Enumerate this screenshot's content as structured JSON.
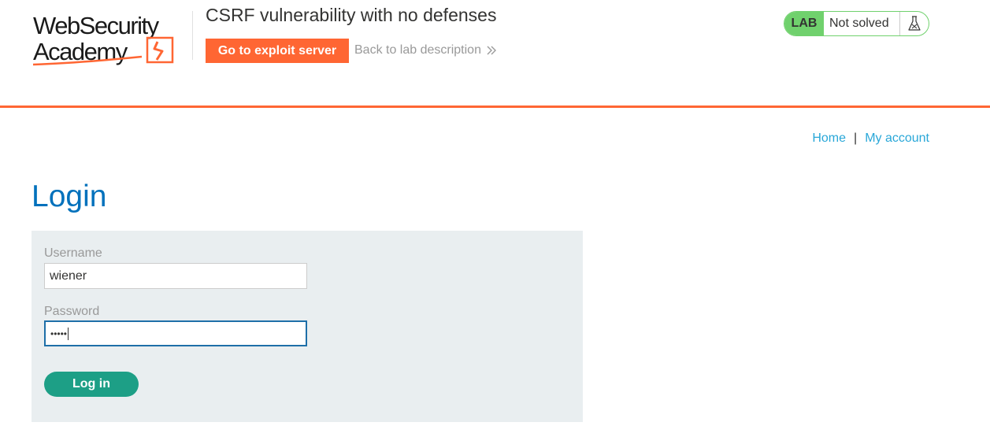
{
  "header": {
    "logo_line1": "WebSecurity",
    "logo_line2": "Academy",
    "lab_title": "CSRF vulnerability with no defenses",
    "exploit_button_label": "Go to exploit server",
    "back_link_label": "Back to lab description",
    "status": {
      "badge": "LAB",
      "text": "Not solved",
      "icon": "flask-icon"
    }
  },
  "nav": {
    "home_label": "Home",
    "separator": "|",
    "account_label": "My account"
  },
  "main": {
    "title": "Login",
    "form": {
      "username_label": "Username",
      "username_value": "wiener",
      "password_label": "Password",
      "password_masked": "•••••",
      "submit_label": "Log in"
    }
  },
  "colors": {
    "brand_orange": "#ff6633",
    "status_green": "#70d16d",
    "link_blue": "#29a7d8",
    "title_blue": "#0071bc",
    "button_teal": "#1d9f86",
    "panel_bg": "#e9eef0"
  }
}
